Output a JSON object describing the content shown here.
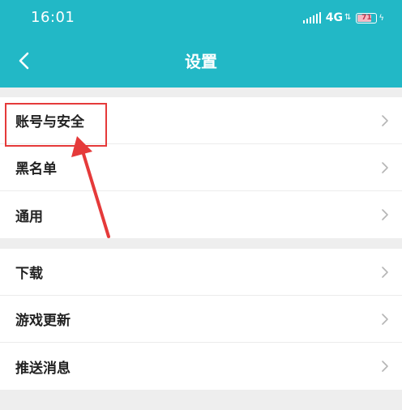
{
  "status_bar": {
    "time": "16:01",
    "network": "4G",
    "battery_level": "71"
  },
  "header": {
    "title": "设置",
    "back_icon": "chevron-left-icon"
  },
  "groups": [
    {
      "items": [
        {
          "label": "账号与安全"
        },
        {
          "label": "黑名单"
        },
        {
          "label": "通用"
        }
      ]
    },
    {
      "items": [
        {
          "label": "下载"
        },
        {
          "label": "游戏更新"
        },
        {
          "label": "推送消息"
        }
      ]
    }
  ],
  "colors": {
    "header_bg": "#22b8c6",
    "annotation": "#e53a3a"
  }
}
